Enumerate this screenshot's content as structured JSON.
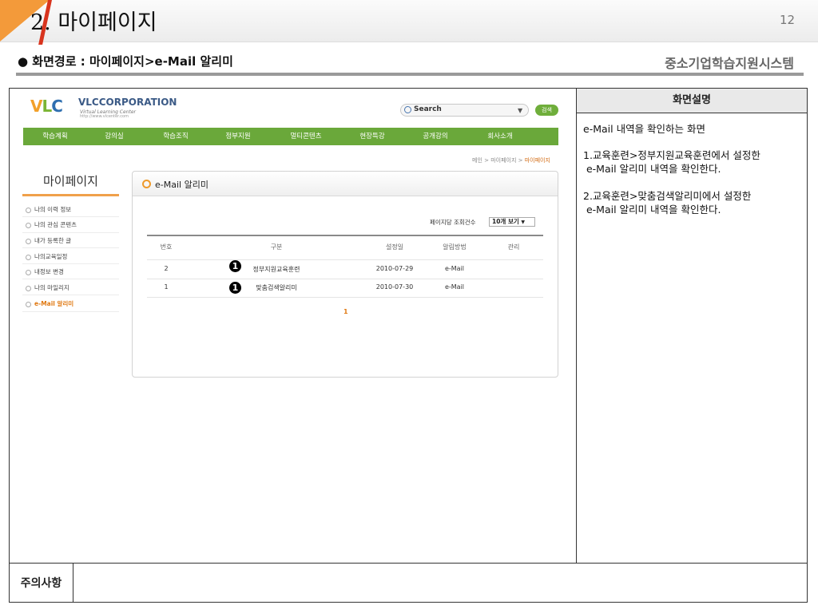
{
  "slide": {
    "title": "2. 마이페이지",
    "page_number": "12",
    "path": "● 화면경로 : 마이페이지>e-Mail 알리미",
    "system_name": "중소기업학습지원시스템"
  },
  "description": {
    "header": "화면설명",
    "lines": [
      "e-Mail 내역을 확인하는 화면",
      "1.교육훈련>정부지원교육훈련에서 설정한",
      " e-Mail 알리미 내역을 확인한다.",
      "2.교육훈련>맞춤검색알리미에서 설정한",
      " e-Mail 알리미 내역을 확인한다."
    ]
  },
  "notes": {
    "label": "주의사항"
  },
  "site": {
    "logo_mark": "VLC",
    "logo_corp": "VLCCORPORATION",
    "logo_sub1": "Virtual Learning Center",
    "logo_sub2": "http://www.vlcenter.com",
    "search_placeholder": "Search",
    "search_button": "검색",
    "nav": [
      "학습계획",
      "강의실",
      "학습조직",
      "정부지원",
      "멀티콘텐츠",
      "현장특강",
      "공개강의",
      "회사소개"
    ],
    "breadcrumb": {
      "prefix": "메인 > 마이페이지 > ",
      "current": "마이페이지"
    },
    "sidebar": {
      "title": "마이페이지",
      "items": [
        "나의 이력 정보",
        "나의 관심 콘텐츠",
        "내가 등록한 글",
        "나의교육일정",
        "내정보 변경",
        "나의 마일리지",
        "e-Mail 알리미"
      ],
      "active_index": 6
    },
    "panel": {
      "title": "e-Mail 알리미",
      "per_page_label": "페이지당 조회건수",
      "per_page_value": "10개 보기",
      "columns": [
        "번호",
        "구분",
        "설정일",
        "알림방법",
        "관리"
      ],
      "rows": [
        {
          "no": "2",
          "category": "정부지원교육훈련",
          "date": "2010-07-29",
          "method": "e-Mail",
          "marker": "1"
        },
        {
          "no": "1",
          "category": "맞춤검색알리미",
          "date": "2010-07-30",
          "method": "e-Mail",
          "marker": "1"
        }
      ],
      "pager": "1"
    }
  },
  "colors": {
    "accent_orange": "#f39a3a",
    "accent_red": "#d8341e",
    "nav_green": "#6aa83a",
    "active_orange": "#e07a14"
  }
}
